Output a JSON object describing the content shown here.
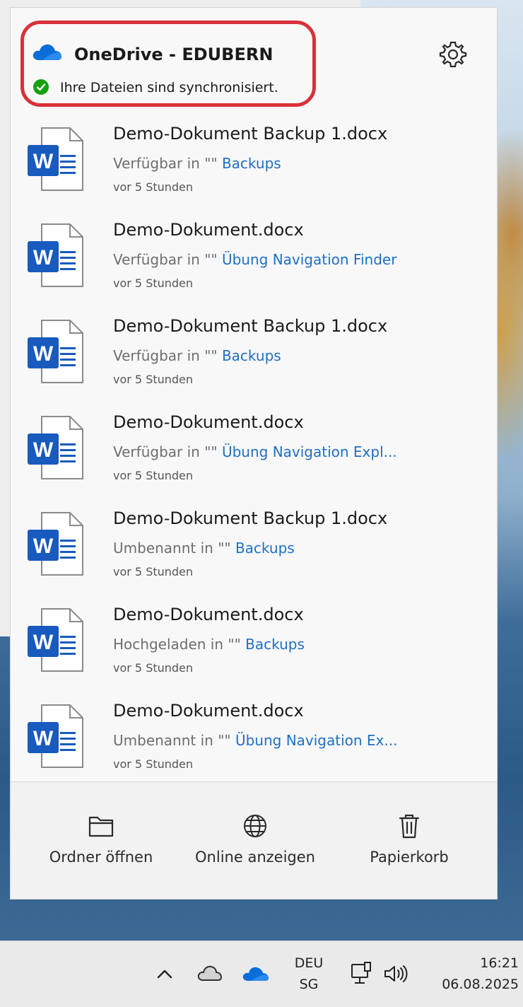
{
  "header": {
    "title": "OneDrive - EDUBERN",
    "status": "Ihre Dateien sind synchronisiert."
  },
  "colors": {
    "accent_link": "#1f6fc5",
    "word_blue": "#185abd",
    "highlight_red": "#d9313a",
    "status_green": "#13a10e",
    "onedrive_blue": "#0a6dd8"
  },
  "activity": [
    {
      "name": "Demo-Dokument Backup 1.docx",
      "action": "Verfügbar in \"\"",
      "folder": "Backups",
      "time": "vor 5 Stunden"
    },
    {
      "name": "Demo-Dokument.docx",
      "action": "Verfügbar in \"\"",
      "folder": "Übung Navigation Finder",
      "time": "vor 5 Stunden"
    },
    {
      "name": "Demo-Dokument Backup 1.docx",
      "action": "Verfügbar in \"\"",
      "folder": "Backups",
      "time": "vor 5 Stunden"
    },
    {
      "name": "Demo-Dokument.docx",
      "action": "Verfügbar in \"\"",
      "folder": "Übung Navigation Expl...",
      "time": "vor 5 Stunden"
    },
    {
      "name": "Demo-Dokument Backup 1.docx",
      "action": "Umbenannt in \"\"",
      "folder": "Backups",
      "time": "vor 5 Stunden"
    },
    {
      "name": "Demo-Dokument.docx",
      "action": "Hochgeladen in \"\"",
      "folder": "Backups",
      "time": "vor 5 Stunden"
    },
    {
      "name": "Demo-Dokument.docx",
      "action": "Umbenannt in \"\"",
      "folder": "Übung Navigation Ex...",
      "time": "vor 5 Stunden"
    }
  ],
  "footer": {
    "open_folder": "Ordner öffnen",
    "view_online": "Online anzeigen",
    "recycle_bin": "Papierkorb"
  },
  "taskbar": {
    "lang_line1": "DEU",
    "lang_line2": "SG",
    "time": "16:21",
    "date": "06.08.2025"
  }
}
